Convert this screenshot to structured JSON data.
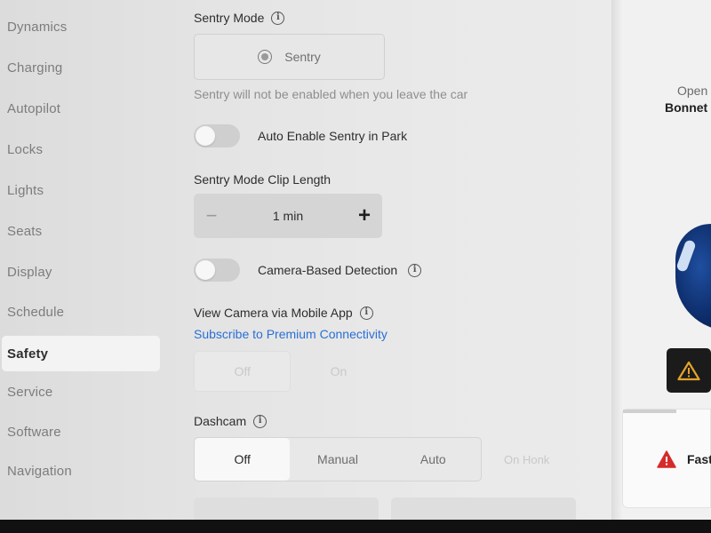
{
  "sidebar": {
    "items": [
      {
        "label": "Dynamics"
      },
      {
        "label": "Charging"
      },
      {
        "label": "Autopilot"
      },
      {
        "label": "Locks"
      },
      {
        "label": "Lights"
      },
      {
        "label": "Seats"
      },
      {
        "label": "Display"
      },
      {
        "label": "Schedule"
      },
      {
        "label": "Safety",
        "active": true
      },
      {
        "label": "Service"
      },
      {
        "label": "Software"
      },
      {
        "label": "Navigation"
      }
    ]
  },
  "sentry": {
    "title": "Sentry Mode",
    "button_label": "Sentry",
    "hint": "Sentry will not be enabled when you leave the car",
    "auto_enable_label": "Auto Enable Sentry in Park",
    "auto_enable_on": false
  },
  "clip_length": {
    "title": "Sentry Mode Clip Length",
    "value": "1 min",
    "minus": "−",
    "plus": "+"
  },
  "camera_detection": {
    "label": "Camera-Based Detection",
    "on": false
  },
  "mobile_camera": {
    "title": "View Camera via Mobile App",
    "link": "Subscribe to Premium Connectivity",
    "options": [
      "Off",
      "On"
    ],
    "selected": "Off"
  },
  "dashcam": {
    "title": "Dashcam",
    "options": [
      "Off",
      "Manual",
      "Auto"
    ],
    "selected": "Off",
    "extra_option": "On Honk"
  },
  "right_panel": {
    "open_label": "Open",
    "bonnet_label": "Bonnet",
    "alert_label": "Fast"
  },
  "colors": {
    "link": "#2a6fd6",
    "warning": "#e4a22a",
    "alert_red": "#d62b2b",
    "car_blue": "#0c2a66"
  }
}
